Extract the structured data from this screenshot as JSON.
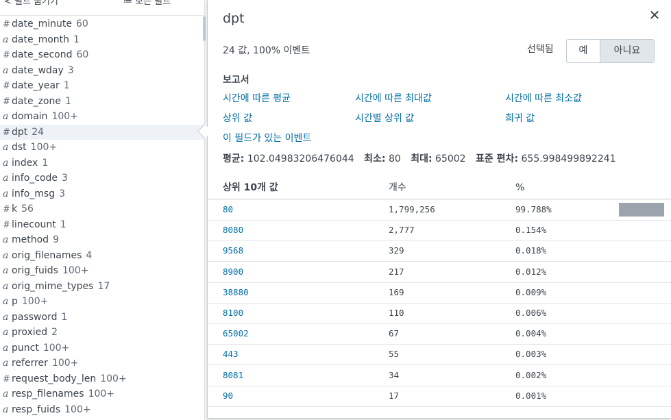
{
  "sidebar": {
    "top_left": "< 필드 숨기기",
    "top_right": "≔ 모든 필드",
    "fields": [
      {
        "type": "#",
        "name": "date_minute",
        "count": "60"
      },
      {
        "type": "a",
        "name": "date_month",
        "count": "1"
      },
      {
        "type": "#",
        "name": "date_second",
        "count": "60"
      },
      {
        "type": "a",
        "name": "date_wday",
        "count": "3"
      },
      {
        "type": "#",
        "name": "date_year",
        "count": "1"
      },
      {
        "type": "#",
        "name": "date_zone",
        "count": "1"
      },
      {
        "type": "a",
        "name": "domain",
        "count": "100+"
      },
      {
        "type": "#",
        "name": "dpt",
        "count": "24"
      },
      {
        "type": "a",
        "name": "dst",
        "count": "100+"
      },
      {
        "type": "a",
        "name": "index",
        "count": "1"
      },
      {
        "type": "a",
        "name": "info_code",
        "count": "3"
      },
      {
        "type": "a",
        "name": "info_msg",
        "count": "3"
      },
      {
        "type": "#",
        "name": "k",
        "count": "56"
      },
      {
        "type": "#",
        "name": "linecount",
        "count": "1"
      },
      {
        "type": "a",
        "name": "method",
        "count": "9"
      },
      {
        "type": "a",
        "name": "orig_filenames",
        "count": "4"
      },
      {
        "type": "a",
        "name": "orig_fuids",
        "count": "100+"
      },
      {
        "type": "a",
        "name": "orig_mime_types",
        "count": "17"
      },
      {
        "type": "a",
        "name": "p",
        "count": "100+"
      },
      {
        "type": "a",
        "name": "password",
        "count": "1"
      },
      {
        "type": "a",
        "name": "proxied",
        "count": "2"
      },
      {
        "type": "a",
        "name": "punct",
        "count": "100+"
      },
      {
        "type": "a",
        "name": "referrer",
        "count": "100+"
      },
      {
        "type": "#",
        "name": "request_body_len",
        "count": "100+"
      },
      {
        "type": "a",
        "name": "resp_filenames",
        "count": "100+"
      },
      {
        "type": "a",
        "name": "resp_fuids",
        "count": "100+"
      }
    ],
    "selected_field": "dpt"
  },
  "popup": {
    "title": "dpt",
    "close_icon": "close-icon",
    "summary": "24 값, 100% 이벤트",
    "selected_label": "선택됨",
    "toggle_yes": "예",
    "toggle_no": "아니요",
    "reports_title": "보고서",
    "links": {
      "avg_over_time": "시간에 따른 평균",
      "max_over_time": "시간에 따른 최대값",
      "min_over_time": "시간에 따른 최소값",
      "top_values": "상위 값",
      "top_values_by_time": "시간별 상위 값",
      "rare_values": "희귀 값",
      "events_with_field": "이 필드가 있는 이벤트"
    },
    "stats": {
      "avg_label": "평균:",
      "avg_value": "102.04983206476044",
      "min_label": "최소:",
      "min_value": "80",
      "max_label": "최대:",
      "max_value": "65002",
      "stdev_label": "표준 편차:",
      "stdev_value": "655.998499892241"
    },
    "table": {
      "col_value": "상위 10개 값",
      "col_count": "개수",
      "col_pct": "%",
      "rows": [
        {
          "value": "80",
          "count": "1,799,256",
          "pct": "99.788%",
          "fraction": 0.99788
        },
        {
          "value": "8080",
          "count": "2,777",
          "pct": "0.154%",
          "fraction": 0.00154
        },
        {
          "value": "9568",
          "count": "329",
          "pct": "0.018%",
          "fraction": 0.00018
        },
        {
          "value": "8900",
          "count": "217",
          "pct": "0.012%",
          "fraction": 0.00012
        },
        {
          "value": "38880",
          "count": "169",
          "pct": "0.009%",
          "fraction": 9e-05
        },
        {
          "value": "8100",
          "count": "110",
          "pct": "0.006%",
          "fraction": 6e-05
        },
        {
          "value": "65002",
          "count": "67",
          "pct": "0.004%",
          "fraction": 4e-05
        },
        {
          "value": "443",
          "count": "55",
          "pct": "0.003%",
          "fraction": 3e-05
        },
        {
          "value": "8081",
          "count": "34",
          "pct": "0.002%",
          "fraction": 2e-05
        },
        {
          "value": "90",
          "count": "17",
          "pct": "0.001%",
          "fraction": 1e-05
        }
      ]
    }
  },
  "colors": {
    "link": "#006eaa",
    "bar": "#9ba3ad",
    "text": "#3c444d"
  }
}
